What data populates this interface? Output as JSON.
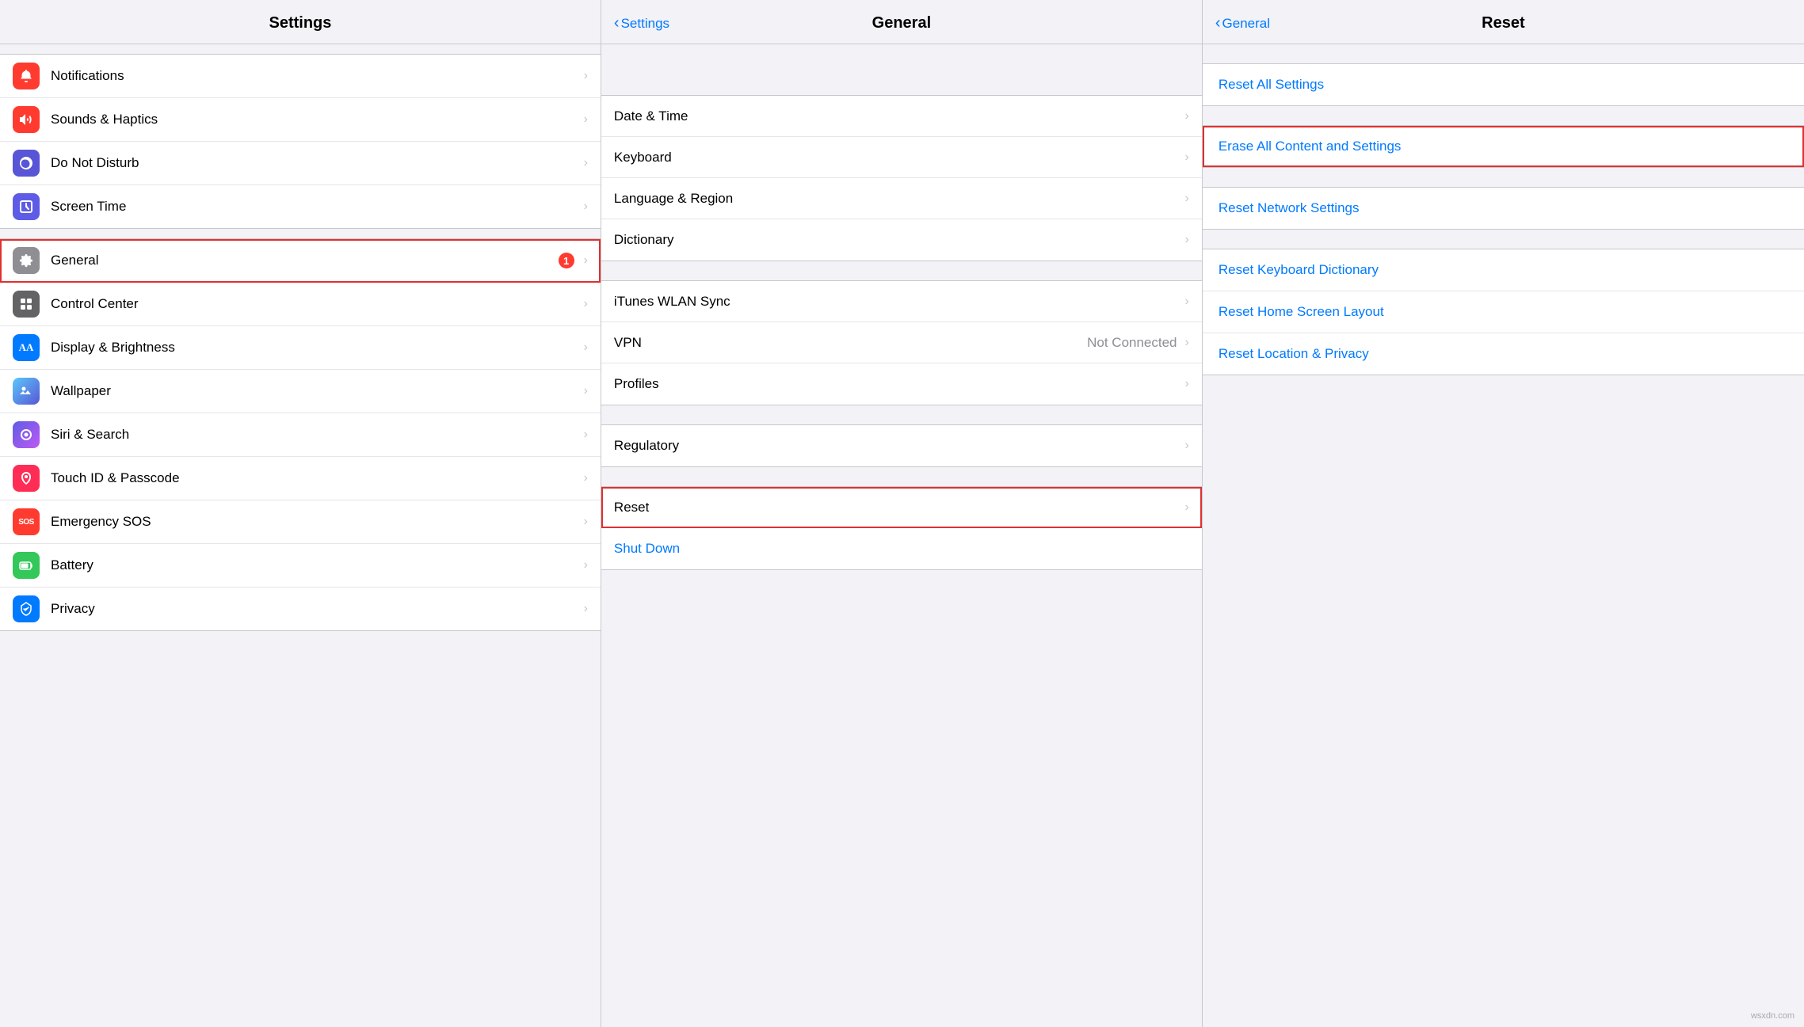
{
  "settings_column": {
    "title": "Settings",
    "groups": [
      {
        "items": [
          {
            "id": "notifications",
            "label": "Notifications",
            "icon": "🔔",
            "icon_bg": "icon-red",
            "badge": null
          },
          {
            "id": "sounds",
            "label": "Sounds & Haptics",
            "icon": "🔊",
            "icon_bg": "icon-red",
            "badge": null
          },
          {
            "id": "donotdisturb",
            "label": "Do Not Disturb",
            "icon": "🌙",
            "icon_bg": "icon-purple",
            "badge": null
          },
          {
            "id": "screentime",
            "label": "Screen Time",
            "icon": "⏳",
            "icon_bg": "icon-indigo",
            "badge": null
          }
        ]
      },
      {
        "items": [
          {
            "id": "general",
            "label": "General",
            "icon": "⚙️",
            "icon_bg": "icon-gray",
            "badge": "1",
            "highlighted": true
          },
          {
            "id": "controlcenter",
            "label": "Control Center",
            "icon": "⊞",
            "icon_bg": "icon-darkgray",
            "badge": null
          },
          {
            "id": "displaybrightness",
            "label": "Display & Brightness",
            "icon": "AA",
            "icon_bg": "icon-blue",
            "badge": null
          },
          {
            "id": "wallpaper",
            "label": "Wallpaper",
            "icon": "✦",
            "icon_bg": "icon-teal",
            "badge": null
          },
          {
            "id": "sirisearch",
            "label": "Siri & Search",
            "icon": "◎",
            "icon_bg": "icon-indigo",
            "badge": null
          },
          {
            "id": "touchid",
            "label": "Touch ID & Passcode",
            "icon": "◉",
            "icon_bg": "icon-pink",
            "badge": null
          },
          {
            "id": "emergencysos",
            "label": "Emergency SOS",
            "icon": "SOS",
            "icon_bg": "icon-red",
            "badge": null
          },
          {
            "id": "battery",
            "label": "Battery",
            "icon": "🔋",
            "icon_bg": "icon-green",
            "badge": null
          },
          {
            "id": "privacy",
            "label": "Privacy",
            "icon": "✋",
            "icon_bg": "icon-blue",
            "badge": null
          }
        ]
      }
    ]
  },
  "general_column": {
    "title": "General",
    "back_label": "Settings",
    "groups": [
      {
        "items": [
          {
            "id": "datetime",
            "label": "Date & Time",
            "value": null
          },
          {
            "id": "keyboard",
            "label": "Keyboard",
            "value": null
          },
          {
            "id": "language",
            "label": "Language & Region",
            "value": null
          },
          {
            "id": "dictionary",
            "label": "Dictionary",
            "value": null
          }
        ]
      },
      {
        "items": [
          {
            "id": "ituneswlan",
            "label": "iTunes WLAN Sync",
            "value": null
          },
          {
            "id": "vpn",
            "label": "VPN",
            "value": "Not Connected"
          },
          {
            "id": "profiles",
            "label": "Profiles",
            "value": null
          }
        ]
      },
      {
        "items": [
          {
            "id": "regulatory",
            "label": "Regulatory",
            "value": null
          }
        ]
      },
      {
        "items": [
          {
            "id": "reset",
            "label": "Reset",
            "value": null,
            "highlighted": true
          },
          {
            "id": "shutdown",
            "label": "Shut Down",
            "value": null,
            "blue": true
          }
        ]
      }
    ]
  },
  "reset_column": {
    "title": "Reset",
    "back_label": "General",
    "groups": [
      {
        "items": [
          {
            "id": "resetallsettings",
            "label": "Reset All Settings"
          }
        ]
      },
      {
        "items": [
          {
            "id": "eraseall",
            "label": "Erase All Content and Settings",
            "highlighted": true
          }
        ]
      },
      {
        "items": [
          {
            "id": "resetnetwork",
            "label": "Reset Network Settings"
          }
        ]
      },
      {
        "items": [
          {
            "id": "resetkeyboard",
            "label": "Reset Keyboard Dictionary"
          },
          {
            "id": "resethomescreen",
            "label": "Reset Home Screen Layout"
          },
          {
            "id": "resetlocation",
            "label": "Reset Location & Privacy"
          }
        ]
      }
    ]
  },
  "watermark": "wsxdn.com"
}
